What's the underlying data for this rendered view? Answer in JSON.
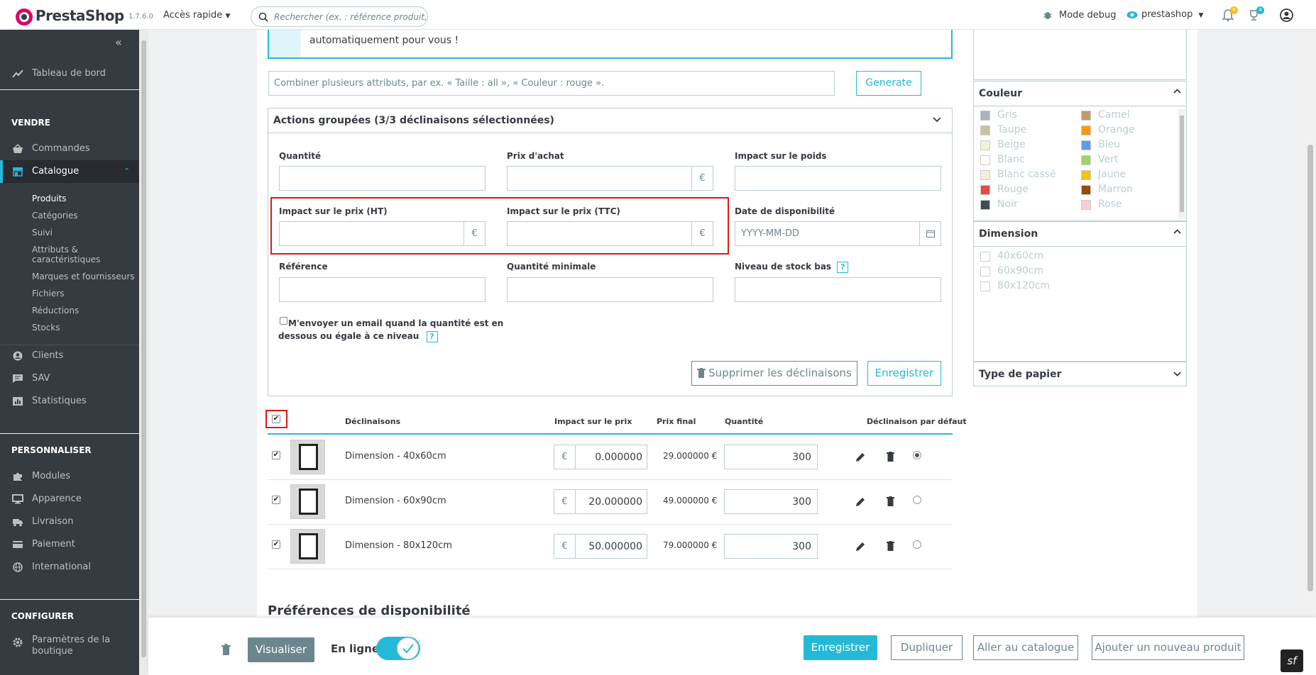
{
  "header": {
    "brand": "PrestaShop",
    "version": "1.7.6.0",
    "quick_access": "Accès rapide",
    "search_placeholder": "Rechercher (ex. : référence produit, nom",
    "debug": "Mode debug",
    "shop": "prestashop",
    "notif_orders": "6",
    "notif_customers": "4"
  },
  "sidebar": {
    "dashboard": "Tableau de bord",
    "sec_sell": "VENDRE",
    "orders": "Commandes",
    "catalog": "Catalogue",
    "catalog_sub": [
      "Produits",
      "Catégories",
      "Suivi",
      "Attributs &",
      "caractéristiques",
      "Marques et fournisseurs",
      "Fichiers",
      "Réductions",
      "Stocks"
    ],
    "customers": "Clients",
    "sav": "SAV",
    "stats": "Statistiques",
    "sec_custom": "PERSONNALISER",
    "modules": "Modules",
    "appearance": "Apparence",
    "shipping": "Livraison",
    "payment": "Paiement",
    "international": "International",
    "sec_config": "CONFIGURER",
    "shop_params_1": "Paramètres de la",
    "shop_params_2": "boutique"
  },
  "main": {
    "info_text": "automatiquement pour vous !",
    "combine_placeholder": "Combiner plusieurs attributs, par ex. « Taille : all », « Couleur : rouge ».",
    "generate": "Generate",
    "bulk_title": "Actions groupées (3/3 déclinaisons sélectionnées)",
    "qty_label": "Quantité",
    "purchase_label": "Prix d'achat",
    "weight_label": "Impact sur le poids",
    "price_ht_label": "Impact sur le prix (HT)",
    "price_ttc_label": "Impact sur le prix (TTC)",
    "date_label": "Date de disponibilité",
    "date_placeholder": "YYYY-MM-DD",
    "ref_label": "Référence",
    "min_qty_label": "Quantité minimale",
    "low_stock_label": "Niveau de stock bas",
    "email_line1": "M'envoyer un email quand la quantité est en",
    "email_line2": "dessous ou égale à ce niveau",
    "currency": "€",
    "help": "?",
    "delete_combos": "Supprimer les déclinaisons",
    "save": "Enregistrer",
    "preferences_title": "Préférences de disponibilité"
  },
  "table": {
    "headers": [
      "Déclinaisons",
      "Impact sur le prix",
      "Prix final",
      "Quantité",
      "Déclinaison par défaut"
    ],
    "rows": [
      {
        "name": "Dimension - 40x60cm",
        "impact": "0.000000",
        "final": "29.000000 €",
        "qty": "300",
        "default": true
      },
      {
        "name": "Dimension - 60x90cm",
        "impact": "20.000000",
        "final": "49.000000 €",
        "qty": "300",
        "default": false
      },
      {
        "name": "Dimension - 80x120cm",
        "impact": "50.000000",
        "final": "79.000000 €",
        "qty": "300",
        "default": false
      }
    ]
  },
  "filters": {
    "color_title": "Couleur",
    "colors_left": [
      {
        "name": "Gris",
        "hex": "#aab2bd"
      },
      {
        "name": "Taupe",
        "hex": "#c7c2a6"
      },
      {
        "name": "Beige",
        "hex": "#f0f5d6"
      },
      {
        "name": "Blanc",
        "hex": "#ffffff"
      },
      {
        "name": "Blanc cassé",
        "hex": "#f8ecdc"
      },
      {
        "name": "Rouge",
        "hex": "#e84c3d"
      },
      {
        "name": "Noir",
        "hex": "#434a54"
      }
    ],
    "colors_right": [
      {
        "name": "Camel",
        "hex": "#c19a6b"
      },
      {
        "name": "Orange",
        "hex": "#f39c11"
      },
      {
        "name": "Bleu",
        "hex": "#5d9cec"
      },
      {
        "name": "Vert",
        "hex": "#a0d468"
      },
      {
        "name": "Jaune",
        "hex": "#f1c40f"
      },
      {
        "name": "Marron",
        "hex": "#964b00"
      },
      {
        "name": "Rose",
        "hex": "#fcccd1"
      }
    ],
    "dimension_title": "Dimension",
    "dimensions": [
      "40x60cm",
      "60x90cm",
      "80x120cm"
    ],
    "paper_title": "Type de papier"
  },
  "footer": {
    "preview": "Visualiser",
    "online": "En ligne",
    "save": "Enregistrer",
    "duplicate": "Dupliquer",
    "to_catalog": "Aller au catalogue",
    "add_new": "Ajouter un nouveau produit"
  }
}
